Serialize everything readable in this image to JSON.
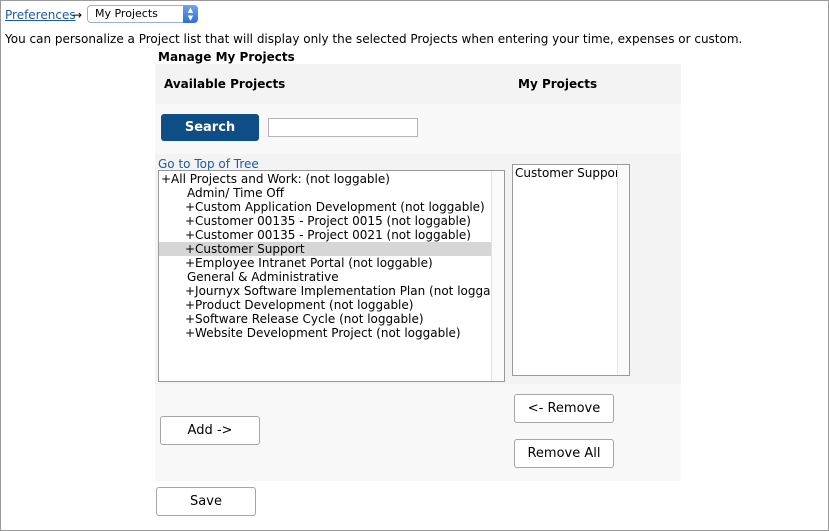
{
  "breadcrumb": {
    "link_label": "Preferences",
    "arrow": "→",
    "current_select": "My Projects"
  },
  "intro_text": "You can personalize a Project list that will display only the selected Projects when entering your time, expenses or custom.",
  "section_title": "Manage My Projects",
  "available": {
    "header": "Available Projects",
    "search_button": "Search",
    "search_value": "",
    "tree_link": "Go to Top of Tree",
    "items": [
      "+All Projects and Work: (not loggable)",
      "Admin/ Time Off",
      "+Custom Application Development (not loggable)",
      "+Customer 00135 - Project 0015 (not loggable)",
      "+Customer 00135 - Project 0021 (not loggable)",
      "+Customer Support",
      "+Employee Intranet Portal (not loggable)",
      "General & Administrative",
      "+Journyx Software Implementation Plan (not loggable)",
      "+Product Development (not loggable)",
      "+Software Release Cycle (not loggable)",
      "+Website Development Project (not loggable)"
    ],
    "selected_item": "+Customer Support"
  },
  "my_projects": {
    "header": "My Projects",
    "items": [
      "Customer Support"
    ]
  },
  "actions": {
    "add": "Add ->",
    "remove": "<- Remove",
    "remove_all": "Remove All",
    "save": "Save"
  }
}
